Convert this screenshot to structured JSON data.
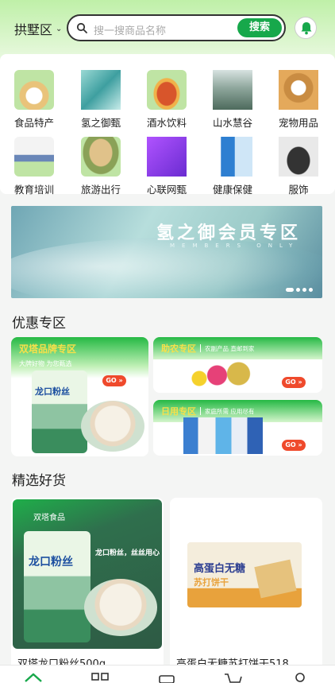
{
  "header": {
    "district": "拱墅区",
    "search_placeholder": "搜一搜商品名称",
    "search_button": "搜索"
  },
  "categories": [
    {
      "label": "食品特产",
      "icon": "food-specialty-thumb",
      "color": "#e9c37a"
    },
    {
      "label": "氢之御甄",
      "icon": "hydrogen-select-thumb",
      "color": "#4fb0ae"
    },
    {
      "label": "酒水饮料",
      "icon": "liquor-thumb",
      "color": "#d8552b"
    },
    {
      "label": "山水慧谷",
      "icon": "landscape-thumb",
      "color": "#6f8d7e"
    },
    {
      "label": "宠物用品",
      "icon": "pet-thumb",
      "color": "#c98c42"
    },
    {
      "label": "教育培训",
      "icon": "education-thumb",
      "color": "#6a87b8"
    },
    {
      "label": "旅游出行",
      "icon": "travel-thumb",
      "color": "#8aa157"
    },
    {
      "label": "心联网甄",
      "icon": "xinlian-thumb",
      "color": "#7b3fd8"
    },
    {
      "label": "健康保健",
      "icon": "health-thumb",
      "color": "#2e7fd1"
    },
    {
      "label": "服饰",
      "icon": "apparel-thumb",
      "color": "#333333"
    }
  ],
  "banner": {
    "title": "氢之御会员专区",
    "subtitle": "MEMBERS ONLY"
  },
  "promo_section": {
    "title": "优惠专区",
    "big": {
      "title": "双塔品牌专区",
      "subtitle": "大牌好物 为您甄选",
      "go": "GO",
      "package_text": "龙口粉丝"
    },
    "items": [
      {
        "title": "助农专区",
        "subtitle": "农副产品 直邮到家",
        "go": "GO"
      },
      {
        "title": "日用专区",
        "subtitle": "家庭所需 应用尽有",
        "go": "GO"
      }
    ]
  },
  "featured_section": {
    "title": "精选好货",
    "products": [
      {
        "name": "双塔龙口粉丝500g",
        "brand": "双塔食品",
        "slogan": "龙口粉丝，丝丝用心",
        "package_text": "龙口粉丝"
      },
      {
        "name": "高蛋白无糖苏打饼干518",
        "package_text": "高蛋白无糖",
        "package_sub": "苏打饼干"
      }
    ]
  },
  "colors": {
    "accent": "#17a84b",
    "header_gradient": "#bff0a8",
    "go_badge": "#ef4a2c",
    "promo_title": "#f7e04a"
  },
  "tabbar": [
    "home-icon",
    "category-icon",
    "wallet-icon",
    "cart-icon",
    "profile-icon"
  ]
}
